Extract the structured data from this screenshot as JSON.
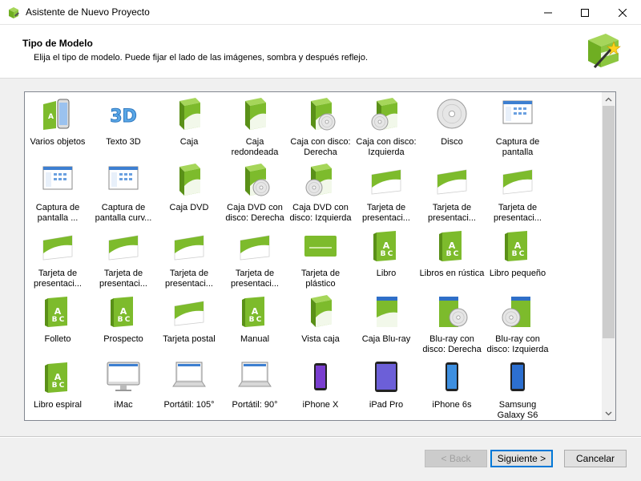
{
  "window": {
    "title": "Asistente de Nuevo Proyecto",
    "app_icon": "wizard-box-icon"
  },
  "header": {
    "title": "Tipo de Modelo",
    "subtitle": "Elija el tipo de modelo. Puede fijar el lado de las imágenes, sombra y después reflejo.",
    "icon": "wizard-wand-icon"
  },
  "colors": {
    "green": "#7dbb2c",
    "green_dark": "#5a9018",
    "accent": "#0078d7"
  },
  "items": [
    {
      "label": "Varios objetos",
      "icon": "multi-objects-icon"
    },
    {
      "label": "Texto 3D",
      "icon": "text-3d-icon"
    },
    {
      "label": "Caja",
      "icon": "box-icon"
    },
    {
      "label": "Caja redondeada",
      "icon": "rounded-box-icon"
    },
    {
      "label": "Caja con disco: Derecha",
      "icon": "box-disc-right-icon"
    },
    {
      "label": "Caja con disco: Izquierda",
      "icon": "box-disc-left-icon"
    },
    {
      "label": "Disco",
      "icon": "disc-icon"
    },
    {
      "label": "Captura de pantalla",
      "icon": "screenshot-icon"
    },
    {
      "label": "Captura de pantalla ...",
      "icon": "screenshot-perspective-icon"
    },
    {
      "label": "Captura de pantalla curv...",
      "icon": "screenshot-curved-icon"
    },
    {
      "label": "Caja DVD",
      "icon": "dvd-box-icon"
    },
    {
      "label": "Caja DVD con disco: Derecha",
      "icon": "dvd-box-disc-right-icon"
    },
    {
      "label": "Caja DVD con disco: Izquierda",
      "icon": "dvd-box-disc-left-icon"
    },
    {
      "label": "Tarjeta de presentaci...",
      "icon": "business-card-icon"
    },
    {
      "label": "Tarjeta de presentaci...",
      "icon": "business-card-icon"
    },
    {
      "label": "Tarjeta de presentaci...",
      "icon": "business-card-icon"
    },
    {
      "label": "Tarjeta de presentaci...",
      "icon": "business-card-icon"
    },
    {
      "label": "Tarjeta de presentaci...",
      "icon": "business-card-icon"
    },
    {
      "label": "Tarjeta de presentaci...",
      "icon": "business-card-icon"
    },
    {
      "label": "Tarjeta de presentaci...",
      "icon": "business-card-icon"
    },
    {
      "label": "Tarjeta de plástico",
      "icon": "plastic-card-icon"
    },
    {
      "label": "Libro",
      "icon": "book-icon"
    },
    {
      "label": "Libros en rústica",
      "icon": "paperback-icon"
    },
    {
      "label": "Libro pequeño",
      "icon": "small-book-icon"
    },
    {
      "label": "Folleto",
      "icon": "brochure-icon"
    },
    {
      "label": "Prospecto",
      "icon": "leaflet-icon"
    },
    {
      "label": "Tarjeta postal",
      "icon": "postcard-icon"
    },
    {
      "label": "Manual",
      "icon": "manual-icon"
    },
    {
      "label": "Vista caja",
      "icon": "box-view-icon"
    },
    {
      "label": "Caja Blu-ray",
      "icon": "bluray-box-icon"
    },
    {
      "label": "Blu-ray con disco: Derecha",
      "icon": "bluray-disc-right-icon"
    },
    {
      "label": "Blu-ray con disco: Izquierda",
      "icon": "bluray-disc-left-icon"
    },
    {
      "label": "Libro espiral",
      "icon": "spiral-book-icon"
    },
    {
      "label": "iMac",
      "icon": "imac-icon"
    },
    {
      "label": "Portátil: 105°",
      "icon": "laptop-105-icon"
    },
    {
      "label": "Portátil: 90°",
      "icon": "laptop-90-icon"
    },
    {
      "label": "iPhone X",
      "icon": "iphone-x-icon"
    },
    {
      "label": "iPad Pro",
      "icon": "ipad-pro-icon"
    },
    {
      "label": "iPhone 6s",
      "icon": "iphone-6s-icon"
    },
    {
      "label": "Samsung Galaxy S6",
      "icon": "galaxy-s6-icon"
    }
  ],
  "buttons": {
    "back": "< Back",
    "next": "Siguiente >",
    "cancel": "Cancelar"
  }
}
